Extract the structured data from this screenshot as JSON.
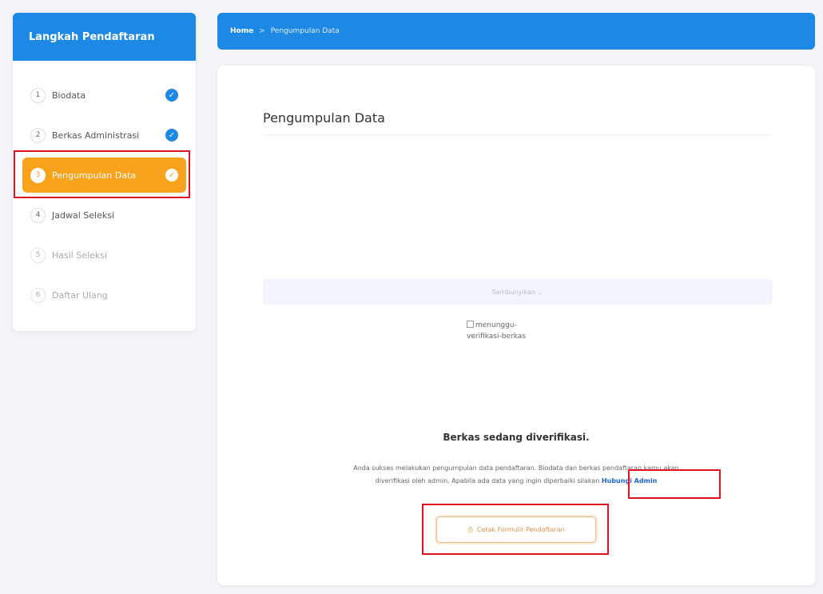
{
  "sidebar": {
    "title": "Langkah Pendaftaran",
    "steps": [
      {
        "num": "1",
        "label": "Biodata",
        "check": "✓"
      },
      {
        "num": "2",
        "label": "Berkas Administrasi",
        "check": "✓"
      },
      {
        "num": "3",
        "label": "Pengumpulan Data",
        "check": "✓"
      },
      {
        "num": "4",
        "label": "Jadwal Seleksi"
      },
      {
        "num": "5",
        "label": "Hasil Seleksi"
      },
      {
        "num": "6",
        "label": "Daftar Ulang"
      }
    ]
  },
  "breadcrumb": {
    "home": "Home",
    "separator": ">",
    "current": "Pengumpulan Data"
  },
  "main": {
    "title": "Pengumpulan Data",
    "collapse_label": "Sembunyikan ⌄",
    "image_alt_line1": "menunggu-",
    "image_alt_line2": "verifikasi-berkas",
    "status_title": "Berkas sedang diverifikasi.",
    "status_desc_line1": "Anda sukses melakukan pengumpulan data pendaftaran. Biodata dan berkas pendaftaran kamu akan",
    "status_desc_line2": "diverifikasi oleh admin. Apabila ada data yang ingin diperbaiki silakan",
    "admin_link": "Hubungi Admin",
    "print_button": "Cetak Formulir Pendaftaran",
    "print_icon": "⎙"
  },
  "colors": {
    "primary": "#1e88e5",
    "active": "#f9a21b",
    "highlight": "#e0101e",
    "link": "#1e63d6"
  }
}
